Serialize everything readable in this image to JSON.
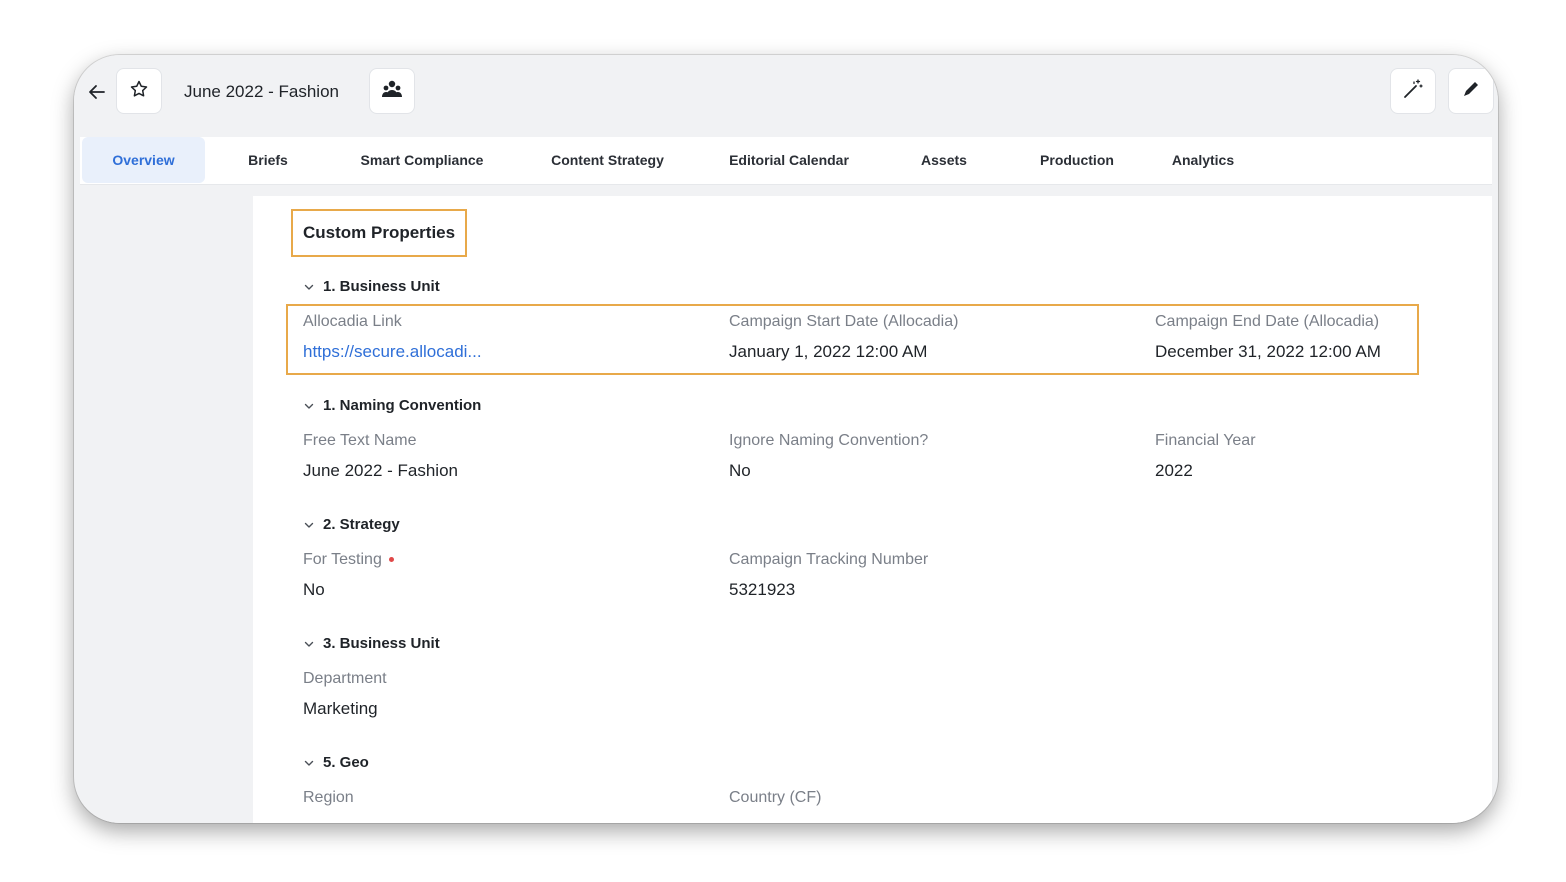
{
  "header": {
    "title": "June 2022 - Fashion",
    "icons": {
      "back": "arrow-left-icon",
      "star": "star-icon",
      "team": "team-icon",
      "magic": "magic-wand-icon",
      "edit": "pencil-icon"
    }
  },
  "tabs": [
    {
      "label": "Overview",
      "active": true
    },
    {
      "label": "Briefs"
    },
    {
      "label": "Smart Compliance"
    },
    {
      "label": "Content Strategy"
    },
    {
      "label": "Editorial Calendar"
    },
    {
      "label": "Assets"
    },
    {
      "label": "Production"
    },
    {
      "label": "Analytics"
    }
  ],
  "colors": {
    "accent": "#2f6fd8",
    "highlight": "#e8a94a",
    "required": "#e04848"
  },
  "content": {
    "title": "Custom Properties",
    "sections": [
      {
        "heading": "1. Business Unit",
        "fields": [
          {
            "label": "Allocadia Link",
            "value": "https://secure.allocadi..."
          },
          {
            "label": "Campaign Start Date (Allocadia)",
            "value": "January 1, 2022 12:00 AM"
          },
          {
            "label": "Campaign End Date (Allocadia)",
            "value": "December 31, 2022 12:00 AM"
          }
        ]
      },
      {
        "heading": "1. Naming Convention",
        "fields": [
          {
            "label": "Free Text Name",
            "value": "June 2022 - Fashion"
          },
          {
            "label": "Ignore Naming Convention?",
            "value": "No"
          },
          {
            "label": "Financial Year",
            "value": "2022"
          }
        ]
      },
      {
        "heading": "2. Strategy",
        "fields": [
          {
            "label": "For Testing",
            "value": "No",
            "required": true
          },
          {
            "label": "Campaign Tracking Number",
            "value": "5321923"
          }
        ]
      },
      {
        "heading": "3. Business Unit",
        "fields": [
          {
            "label": "Department",
            "value": "Marketing"
          }
        ]
      },
      {
        "heading": "5. Geo",
        "fields": [
          {
            "label": "Region"
          },
          {
            "label": "Country (CF)"
          }
        ]
      }
    ]
  }
}
